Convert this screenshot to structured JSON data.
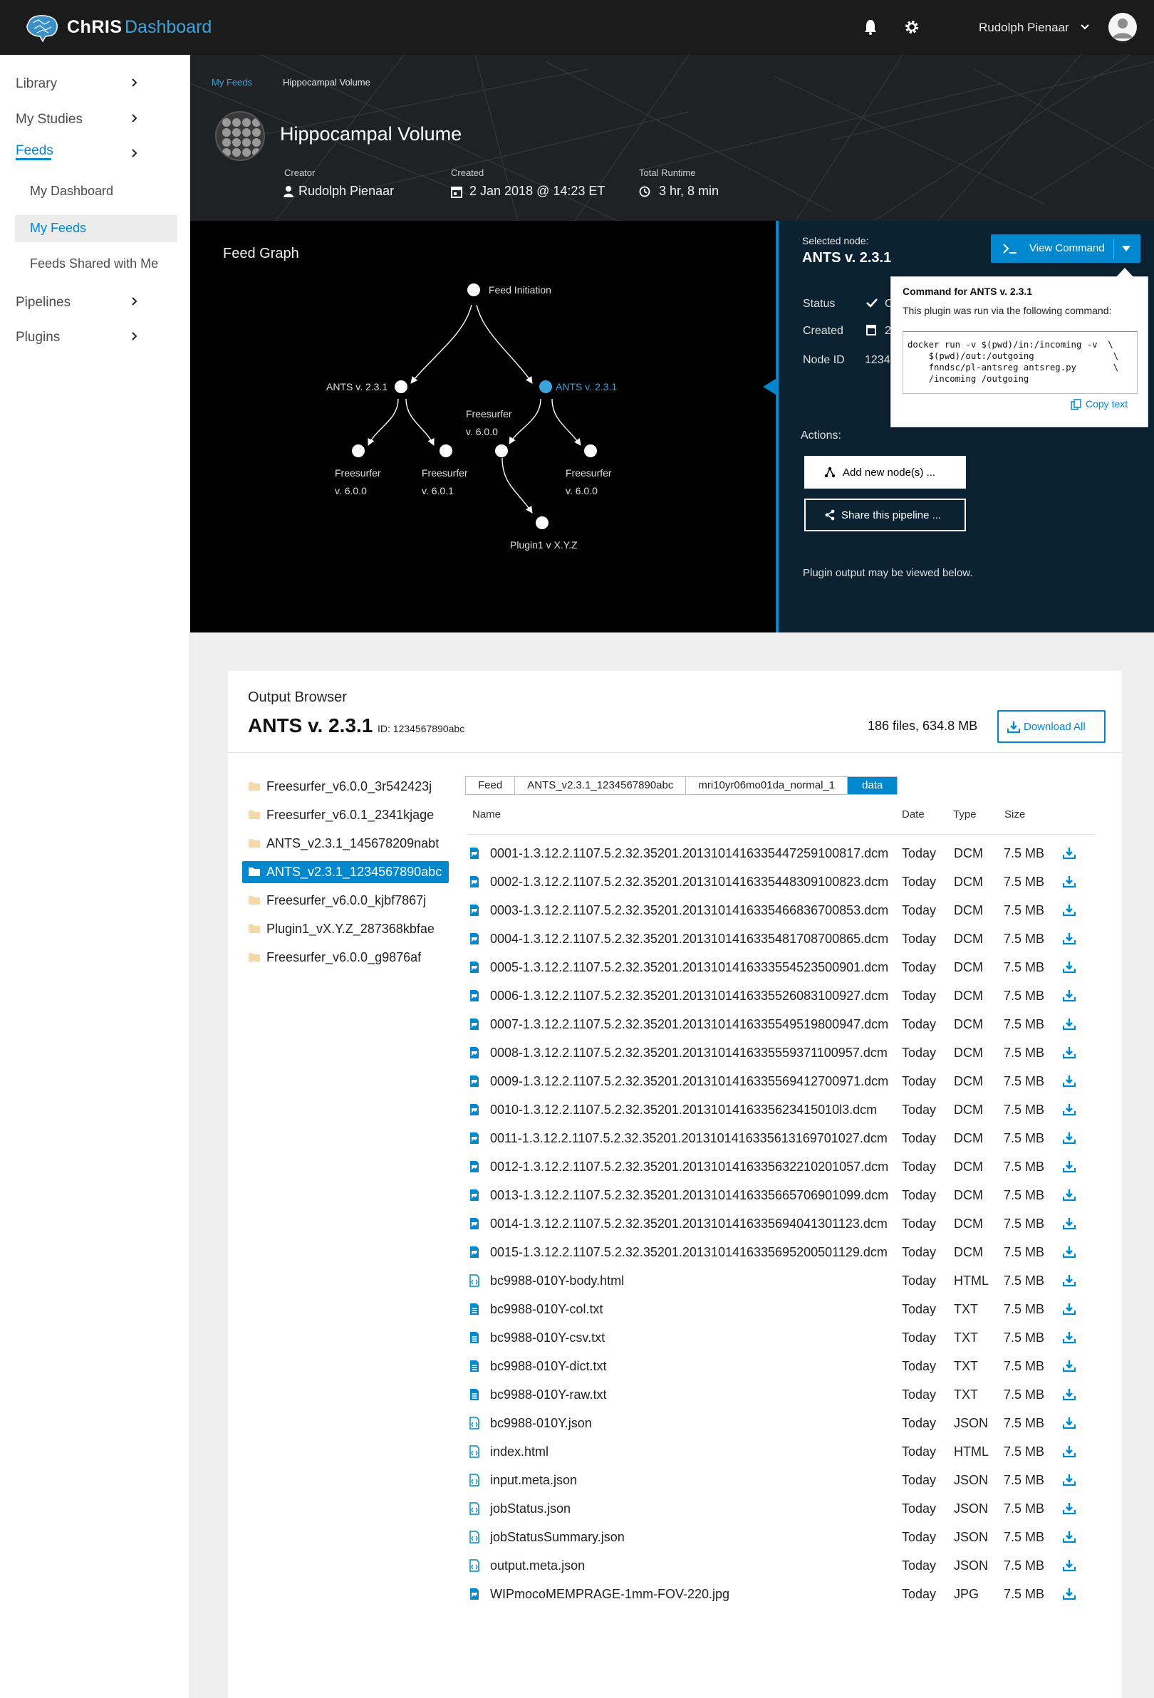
{
  "app": {
    "brand": "ChRIS",
    "title": "Dashboard",
    "user": "Rudolph Pienaar"
  },
  "sidebar": {
    "items": [
      {
        "label": "Library"
      },
      {
        "label": "My Studies"
      },
      {
        "label": "Feeds"
      },
      {
        "label": "Pipelines"
      },
      {
        "label": "Plugins"
      }
    ],
    "feeds_sub": [
      {
        "label": "My Dashboard"
      },
      {
        "label": "My Feeds"
      },
      {
        "label": "Feeds Shared with Me"
      }
    ]
  },
  "header": {
    "breadcrumb": [
      "My Feeds",
      "Hippocampal Volume"
    ],
    "title": "Hippocampal Volume",
    "creator_label": "Creator",
    "creator": "Rudolph Pienaar",
    "created_label": "Created",
    "created": "2 Jan 2018 @ 14:23 ET",
    "runtime_label": "Total Runtime",
    "runtime": "3 hr, 8 min"
  },
  "graph": {
    "title": "Feed Graph",
    "root": "Feed Initiation",
    "node_left": "ANTS v. 2.3.1",
    "node_right": "ANTS v. 2.3.1",
    "fs_mid_1": "Freesurfer",
    "fs_mid_2": "v. 6.0.0",
    "fs_a_1": "Freesurfer",
    "fs_a_2": "v. 6.0.0",
    "fs_b_1": "Freesurfer",
    "fs_b_2": "v. 6.0.1",
    "fs_c_1": "Freesurfer",
    "fs_c_2": "v. 6.0.0",
    "plugin": "Plugin1 v X.Y.Z",
    "selected_color": "#39a5dc"
  },
  "node_panel": {
    "selected_label": "Selected node:",
    "selected_name": "ANTS v. 2.3.1",
    "view_command": "View Command",
    "status_label": "Status",
    "status_value": "C",
    "created_label": "Created",
    "created_value": "2",
    "nodeid_label": "Node ID",
    "nodeid_value": "1234",
    "actions_label": "Actions:",
    "add_node": "Add new node(s) ...",
    "share": "Share this pipeline ...",
    "note": "Plugin output may be viewed below."
  },
  "popover": {
    "title": "Command for ANTS v. 2.3.1",
    "desc": "This plugin was run via the following command:",
    "code": "docker run -v $(pwd)/in:/incoming -v  \\\n    $(pwd)/out:/outgoing               \\\n    fnndsc/pl-antsreg antsreg.py       \\\n    /incoming /outgoing",
    "copy": "Copy text"
  },
  "output": {
    "title": "Output Browser",
    "plugin": "ANTS v. 2.3.1",
    "id": "ID: 1234567890abc",
    "stats": "186 files, 634.8 MB",
    "download_all": "Download All",
    "folders": [
      "Freesurfer_v6.0.0_3r542423j",
      "Freesurfer_v6.0.1_2341kjage",
      "ANTS_v2.3.1_145678209nabt",
      "ANTS_v2.3.1_1234567890abc",
      "Freesurfer_v6.0.0_kjbf7867j",
      "Plugin1_vX.Y.Z_287368kbfae",
      "Freesurfer_v6.0.0_g9876af"
    ],
    "selected_folder": 3,
    "path": [
      "Feed",
      "ANTS_v2.3.1_1234567890abc",
      "mri10yr06mo01da_normal_1",
      "data"
    ],
    "columns": {
      "name": "Name",
      "date": "Date",
      "type": "Type",
      "size": "Size"
    },
    "files": [
      {
        "name": "0001-1.3.12.2.1107.5.2.32.35201.2013101416335447259100817.dcm",
        "date": "Today",
        "type": "DCM",
        "size": "7.5 MB",
        "icon": "image"
      },
      {
        "name": "0002-1.3.12.2.1107.5.2.32.35201.2013101416335448309100823.dcm",
        "date": "Today",
        "type": "DCM",
        "size": "7.5 MB",
        "icon": "image"
      },
      {
        "name": "0003-1.3.12.2.1107.5.2.32.35201.2013101416335466836700853.dcm",
        "date": "Today",
        "type": "DCM",
        "size": "7.5 MB",
        "icon": "image"
      },
      {
        "name": "0004-1.3.12.2.1107.5.2.32.35201.2013101416335481708700865.dcm",
        "date": "Today",
        "type": "DCM",
        "size": "7.5 MB",
        "icon": "image"
      },
      {
        "name": "0005-1.3.12.2.1107.5.2.32.35201.2013101416333554523500901.dcm",
        "date": "Today",
        "type": "DCM",
        "size": "7.5 MB",
        "icon": "image"
      },
      {
        "name": "0006-1.3.12.2.1107.5.2.32.35201.2013101416335526083100927.dcm",
        "date": "Today",
        "type": "DCM",
        "size": "7.5 MB",
        "icon": "image"
      },
      {
        "name": "0007-1.3.12.2.1107.5.2.32.35201.2013101416335549519800947.dcm",
        "date": "Today",
        "type": "DCM",
        "size": "7.5 MB",
        "icon": "image"
      },
      {
        "name": "0008-1.3.12.2.1107.5.2.32.35201.2013101416335559371100957.dcm",
        "date": "Today",
        "type": "DCM",
        "size": "7.5 MB",
        "icon": "image"
      },
      {
        "name": "0009-1.3.12.2.1107.5.2.32.35201.2013101416335569412700971.dcm",
        "date": "Today",
        "type": "DCM",
        "size": "7.5 MB",
        "icon": "image"
      },
      {
        "name": "0010-1.3.12.2.1107.5.2.32.35201.2013101416335623415010l3.dcm",
        "date": "Today",
        "type": "DCM",
        "size": "7.5 MB",
        "icon": "image"
      },
      {
        "name": "0011-1.3.12.2.1107.5.2.32.35201.2013101416335613169701027.dcm",
        "date": "Today",
        "type": "DCM",
        "size": "7.5 MB",
        "icon": "image"
      },
      {
        "name": "0012-1.3.12.2.1107.5.2.32.35201.2013101416335632210201057.dcm",
        "date": "Today",
        "type": "DCM",
        "size": "7.5 MB",
        "icon": "image"
      },
      {
        "name": "0013-1.3.12.2.1107.5.2.32.35201.2013101416335665706901099.dcm",
        "date": "Today",
        "type": "DCM",
        "size": "7.5 MB",
        "icon": "image"
      },
      {
        "name": "0014-1.3.12.2.1107.5.2.32.35201.2013101416335694041301123.dcm",
        "date": "Today",
        "type": "DCM",
        "size": "7.5 MB",
        "icon": "image"
      },
      {
        "name": "0015-1.3.12.2.1107.5.2.32.35201.2013101416335695200501129.dcm",
        "date": "Today",
        "type": "DCM",
        "size": "7.5 MB",
        "icon": "image"
      },
      {
        "name": "bc9988-010Y-body.html",
        "date": "Today",
        "type": "HTML",
        "size": "7.5 MB",
        "icon": "code"
      },
      {
        "name": "bc9988-010Y-col.txt",
        "date": "Today",
        "type": "TXT",
        "size": "7.5 MB",
        "icon": "text"
      },
      {
        "name": "bc9988-010Y-csv.txt",
        "date": "Today",
        "type": "TXT",
        "size": "7.5 MB",
        "icon": "text"
      },
      {
        "name": "bc9988-010Y-dict.txt",
        "date": "Today",
        "type": "TXT",
        "size": "7.5 MB",
        "icon": "text"
      },
      {
        "name": "bc9988-010Y-raw.txt",
        "date": "Today",
        "type": "TXT",
        "size": "7.5 MB",
        "icon": "text"
      },
      {
        "name": "bc9988-010Y.json",
        "date": "Today",
        "type": "JSON",
        "size": "7.5 MB",
        "icon": "code"
      },
      {
        "name": "index.html",
        "date": "Today",
        "type": "HTML",
        "size": "7.5 MB",
        "icon": "code"
      },
      {
        "name": "input.meta.json",
        "date": "Today",
        "type": "JSON",
        "size": "7.5 MB",
        "icon": "code"
      },
      {
        "name": "jobStatus.json",
        "date": "Today",
        "type": "JSON",
        "size": "7.5 MB",
        "icon": "code"
      },
      {
        "name": "jobStatusSummary.json",
        "date": "Today",
        "type": "JSON",
        "size": "7.5 MB",
        "icon": "code"
      },
      {
        "name": "output.meta.json",
        "date": "Today",
        "type": "JSON",
        "size": "7.5 MB",
        "icon": "code"
      },
      {
        "name": "WIPmocoMEMPRAGE-1mm-FOV-220.jpg",
        "date": "Today",
        "type": "JPG",
        "size": "7.5 MB",
        "icon": "image"
      }
    ]
  },
  "colors": {
    "accent": "#0088ce",
    "accent_light": "#39a5dc",
    "topbar": "#1b1b1b",
    "panel": "#0b2233"
  }
}
